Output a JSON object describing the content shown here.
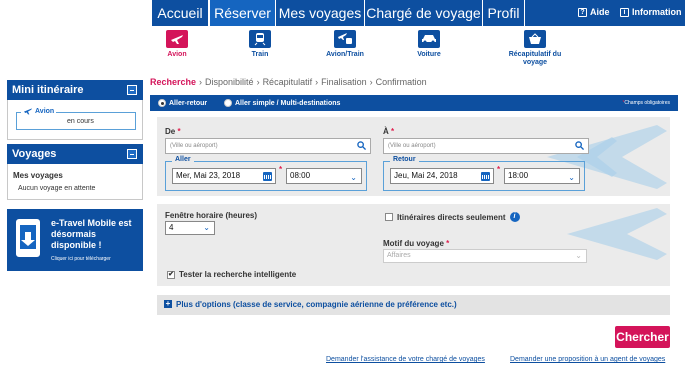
{
  "nav": {
    "tabs": [
      {
        "label": "Accueil",
        "active": false
      },
      {
        "label": "Réserver",
        "active": true
      },
      {
        "label": "Mes voyages",
        "active": false
      },
      {
        "label": "Chargé de voyage",
        "active": false
      },
      {
        "label": "Profil",
        "active": false
      }
    ],
    "help": "Aide",
    "info": "Information"
  },
  "modes": [
    {
      "label": "Avion",
      "icon": "plane-icon",
      "active": true
    },
    {
      "label": "Train",
      "icon": "train-icon",
      "active": false
    },
    {
      "label": "Avion/Train",
      "icon": "plane-train-icon",
      "active": false
    },
    {
      "label": "Voiture",
      "icon": "car-icon",
      "active": false
    },
    {
      "label": "Récapitulatif du voyage",
      "icon": "basket-icon",
      "active": false
    }
  ],
  "mini_itinerary": {
    "title": "Mini itinéraire",
    "item_label": "Avion",
    "item_status": "en cours"
  },
  "trips": {
    "title": "Voyages",
    "subtitle": "Mes voyages",
    "empty": "Aucun voyage en attente"
  },
  "mobile": {
    "title": "e-Travel Mobile est désormais disponible !",
    "link": "Cliquer ici pour télécharger"
  },
  "steps": [
    "Recherche",
    "Disponibilité",
    "Récapitulatif",
    "Finalisation",
    "Confirmation"
  ],
  "trip_type": {
    "round_trip": "Aller-retour",
    "one_way": "Aller simple / Multi-destinations",
    "required_note": "Champs obligatoires"
  },
  "form": {
    "from_label": "De",
    "from_placeholder": "(Ville ou aéroport)",
    "to_label": "À",
    "to_placeholder": "(Ville ou aéroport)",
    "depart_label": "Aller",
    "depart_date": "Mer, Mai 23, 2018",
    "depart_time": "08:00",
    "return_label": "Retour",
    "return_date": "Jeu, Mai 24, 2018",
    "return_time": "18:00",
    "window_label": "Fenêtre horaire (heures)",
    "window_value": "4",
    "direct_label": "Itinéraires directs seulement",
    "reason_label": "Motif du voyage",
    "reason_value": "Affaires",
    "smart_label": "Tester la recherche intelligente",
    "more_options": "Plus d'options (classe de service, compagnie aérienne de préférence etc.)",
    "search_button": "Chercher"
  },
  "footer": {
    "link_agent_assist": "Demander l'assistance de votre chargé de voyages",
    "link_agent_proposal": "Demander une proposition à un agent de voyages"
  },
  "colors": {
    "primary": "#0d4fa0",
    "accent": "#d4145a"
  }
}
